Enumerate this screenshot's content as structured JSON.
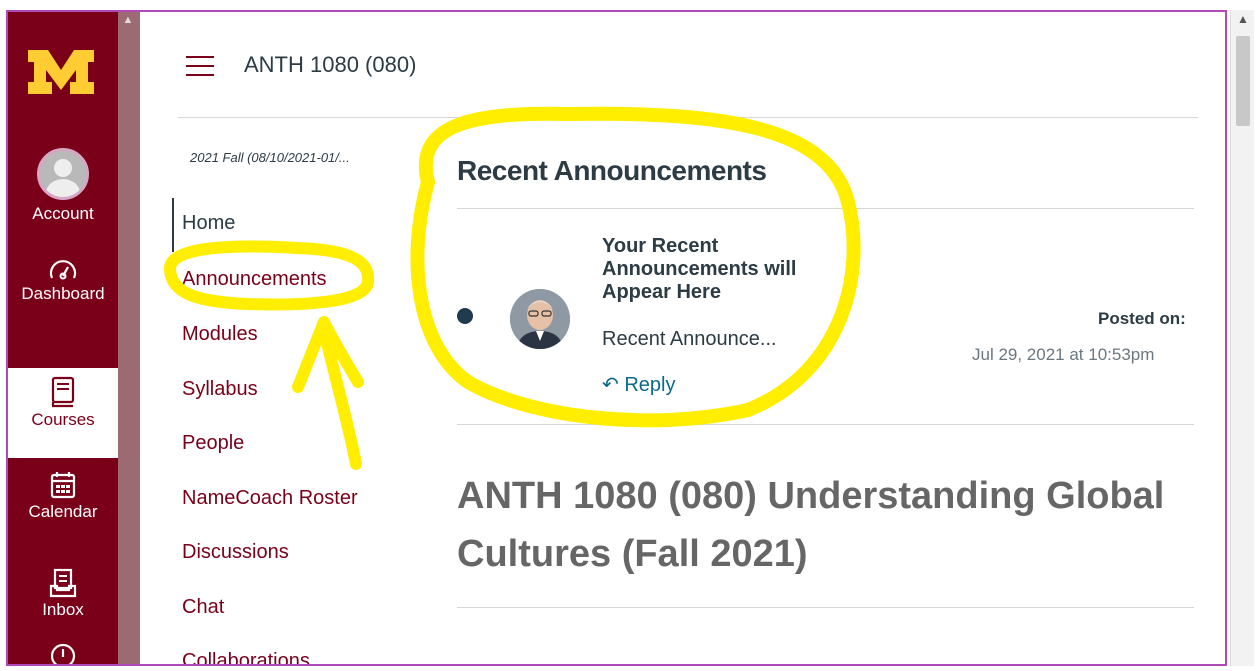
{
  "global_nav": {
    "items": [
      {
        "label": "Account",
        "icon": "account-avatar"
      },
      {
        "label": "Dashboard",
        "icon": "dashboard-icon"
      },
      {
        "label": "Courses",
        "icon": "courses-icon"
      },
      {
        "label": "Calendar",
        "icon": "calendar-icon"
      },
      {
        "label": "Inbox",
        "icon": "inbox-icon"
      }
    ],
    "colors": {
      "background": "#7a0019",
      "logo": "#ffcc33"
    }
  },
  "header": {
    "course_title": "ANTH 1080 (080)"
  },
  "course_nav": {
    "term": "2021 Fall (08/10/2021-01/...",
    "items": [
      "Home",
      "Announcements",
      "Modules",
      "Syllabus",
      "People",
      "NameCoach Roster",
      "Discussions",
      "Chat",
      "Collaborations"
    ]
  },
  "announcements": {
    "title": "Recent Announcements",
    "item": {
      "title": "Your Recent Announcements will Appear Here",
      "excerpt": "Recent Announce...",
      "reply": "Reply",
      "posted_label": "Posted on:",
      "posted_date": "Jul 29, 2021 at 10:53pm"
    }
  },
  "course_heading": "ANTH 1080 (080) Understanding Global Cultures (Fall 2021)",
  "annotation": {
    "color": "#ffee00"
  }
}
